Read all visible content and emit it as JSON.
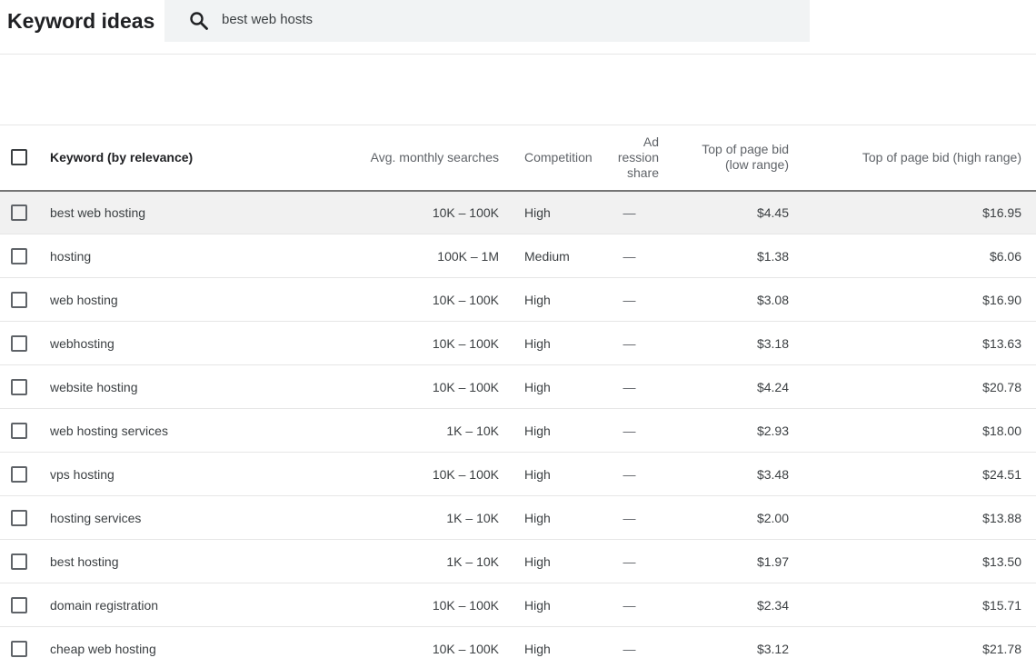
{
  "header": {
    "title": "Keyword ideas",
    "search_value": "best web hosts"
  },
  "table": {
    "columns": {
      "keyword": "Keyword (by relevance)",
      "avg_searches": "Avg. monthly searches",
      "competition": "Competition",
      "ad_share_1": "Ad",
      "ad_share_2": "ression",
      "ad_share_3": "share",
      "low_bid_1": "Top of page bid",
      "low_bid_2": "(low range)",
      "high_bid": "Top of page bid (high range)"
    },
    "rows": [
      {
        "keyword": "best web hosting",
        "searches": "10K – 100K",
        "competition": "High",
        "ad_share": "—",
        "low": "$4.45",
        "high": "$16.95"
      },
      {
        "keyword": "hosting",
        "searches": "100K – 1M",
        "competition": "Medium",
        "ad_share": "—",
        "low": "$1.38",
        "high": "$6.06"
      },
      {
        "keyword": "web hosting",
        "searches": "10K – 100K",
        "competition": "High",
        "ad_share": "—",
        "low": "$3.08",
        "high": "$16.90"
      },
      {
        "keyword": "webhosting",
        "searches": "10K – 100K",
        "competition": "High",
        "ad_share": "—",
        "low": "$3.18",
        "high": "$13.63"
      },
      {
        "keyword": "website hosting",
        "searches": "10K – 100K",
        "competition": "High",
        "ad_share": "—",
        "low": "$4.24",
        "high": "$20.78"
      },
      {
        "keyword": "web hosting services",
        "searches": "1K – 10K",
        "competition": "High",
        "ad_share": "—",
        "low": "$2.93",
        "high": "$18.00"
      },
      {
        "keyword": "vps hosting",
        "searches": "10K – 100K",
        "competition": "High",
        "ad_share": "—",
        "low": "$3.48",
        "high": "$24.51"
      },
      {
        "keyword": "hosting services",
        "searches": "1K – 10K",
        "competition": "High",
        "ad_share": "—",
        "low": "$2.00",
        "high": "$13.88"
      },
      {
        "keyword": "best hosting",
        "searches": "1K – 10K",
        "competition": "High",
        "ad_share": "—",
        "low": "$1.97",
        "high": "$13.50"
      },
      {
        "keyword": "domain registration",
        "searches": "10K – 100K",
        "competition": "High",
        "ad_share": "—",
        "low": "$2.34",
        "high": "$15.71"
      },
      {
        "keyword": "cheap web hosting",
        "searches": "10K – 100K",
        "competition": "High",
        "ad_share": "—",
        "low": "$3.12",
        "high": "$21.78"
      }
    ]
  },
  "icons": {
    "search": "search-icon",
    "checkbox": "checkbox-icon"
  }
}
